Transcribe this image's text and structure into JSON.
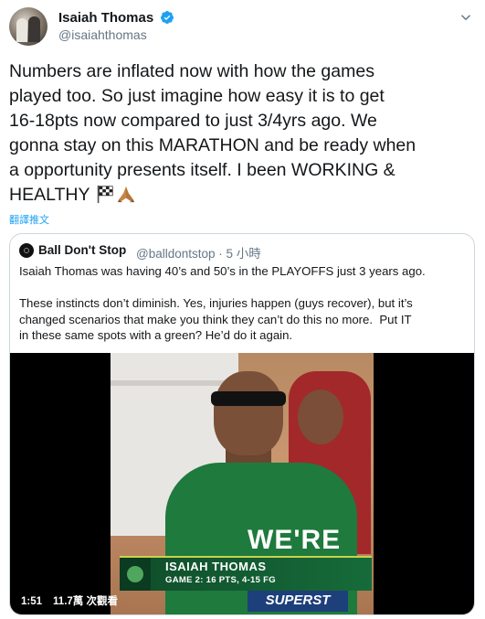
{
  "tweet": {
    "author_name": "Isaiah Thomas",
    "author_handle": "@isaiahthomas",
    "text": "Numbers are inflated now with how the games\nplayed too. So just imagine how easy it is to get\n16-18pts now compared to just 3/4yrs ago. We\ngonna stay on this MARATHON and be ready when\na opportunity presents itself. I been WORKING &\nHEALTHY",
    "emojis": [
      "checkered-flag-icon",
      "folded-hands-icon"
    ],
    "translate_label": "翻譯推文"
  },
  "quote": {
    "author_name": "Ball Don't Stop",
    "author_handle": "@balldontstop",
    "separator": "·",
    "time": "5 小時",
    "text": "Isaiah Thomas was having 40’s and 50’s in the PLAYOFFS just 3 years ago.\n\nThese instincts don’t diminish. Yes, injuries happen (guys recover), but it’s\nchanged scenarios that make you think they can’t do this no more.  Put IT\nin these same spots with a green? He’d do it again."
  },
  "video": {
    "duration": "1:51",
    "views": "11.7萬 次觀看",
    "lower_third_name": "ISAIAH THOMAS",
    "lower_third_stat": "GAME 2: 16 PTS, 4-15 FG",
    "jersey_text": "WE'RE",
    "banner_text": "SUPERST"
  },
  "colors": {
    "link": "#1da1f2",
    "secondary_text": "#657786",
    "border": "#ccd6dd",
    "jersey_green": "#1f7a3d"
  }
}
